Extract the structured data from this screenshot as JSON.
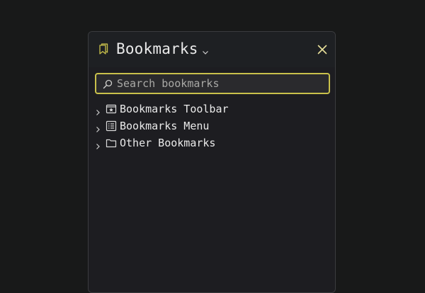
{
  "sidebar": {
    "title": "Bookmarks",
    "search": {
      "placeholder": "Search bookmarks",
      "value": ""
    },
    "items": [
      {
        "label": "Bookmarks Toolbar",
        "icon": "bookmarks-toolbar-icon"
      },
      {
        "label": "Bookmarks Menu",
        "icon": "bookmarks-menu-icon"
      },
      {
        "label": "Other Bookmarks",
        "icon": "folder-icon"
      }
    ]
  },
  "colors": {
    "accent": "#c9c14b",
    "text": "#eaeaea",
    "background": "#181919",
    "panel": "#1d1d21"
  }
}
